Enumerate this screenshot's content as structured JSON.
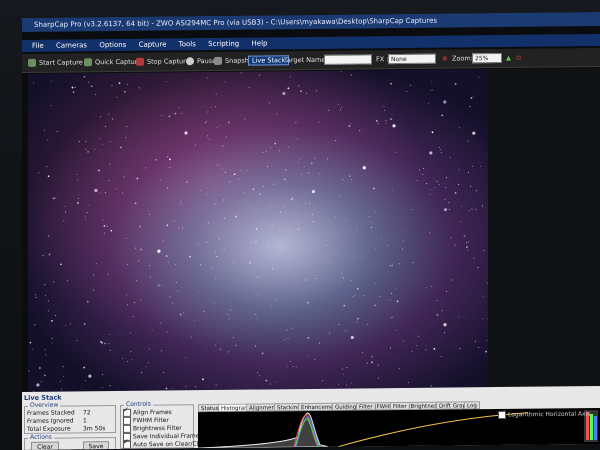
{
  "window": {
    "title": "SharpCap Pro (v3.2.6137, 64 bit) - ZWO ASI294MC Pro (via USB3) - C:\\Users\\myakawa\\Desktop\\SharpCap Captures"
  },
  "menu": [
    "File",
    "Cameras",
    "Options",
    "Capture",
    "Tools",
    "Scripting",
    "Help"
  ],
  "toolbar": {
    "start_capture": "Start Capture",
    "quick_capture": "Quick Capture",
    "stop_capture": "Stop Capture",
    "pause": "Pause",
    "snapshot": "Snapshot",
    "live_stack": "Live Stack",
    "target_name_label": "Target Name :",
    "target_name_value": "",
    "fx_label": "FX :",
    "fx_value": "None",
    "zoom_label": "Zoom:",
    "zoom_value": "25%"
  },
  "live_stack": {
    "title": "Live Stack",
    "overview": {
      "title": "Overview",
      "frames_stacked_label": "Frames Stacked",
      "frames_stacked_value": "72",
      "frames_ignored_label": "Frames Ignored",
      "frames_ignored_value": "1",
      "total_exposure_label": "Total Exposure",
      "total_exposure_value": "3m 50s"
    },
    "actions": {
      "title": "Actions",
      "clear": "Clear",
      "save": "Save",
      "pause": "Pause"
    },
    "controls": {
      "title": "Controls",
      "align_frames": {
        "label": "Align Frames",
        "checked": true
      },
      "fwhm_filter": {
        "label": "FWHM Filter",
        "checked": false
      },
      "brightness_filter": {
        "label": "Brightness Filter",
        "checked": false
      },
      "save_individual_frames": {
        "label": "Save Individual Frames",
        "checked": false
      },
      "auto_save": {
        "label": "Auto Save on Clear/Close",
        "checked": true
      },
      "view_label": "View",
      "view_value": "Stack"
    },
    "tabs": [
      "Status",
      "Histogram",
      "Alignment",
      "Stacking",
      "Enhancement",
      "Guiding",
      "Filter (FWHM)",
      "Filter (Brightness)",
      "Drift Graph",
      "Log"
    ],
    "active_tab": "Histogram",
    "histogram_option": "Logarithmic Horizontal Axis"
  },
  "colors": {
    "title_bar": "#1b3a72",
    "menu_bar": "#12306a",
    "panel": "#e8e8e8",
    "live_stack_accent": "#103a7a"
  }
}
